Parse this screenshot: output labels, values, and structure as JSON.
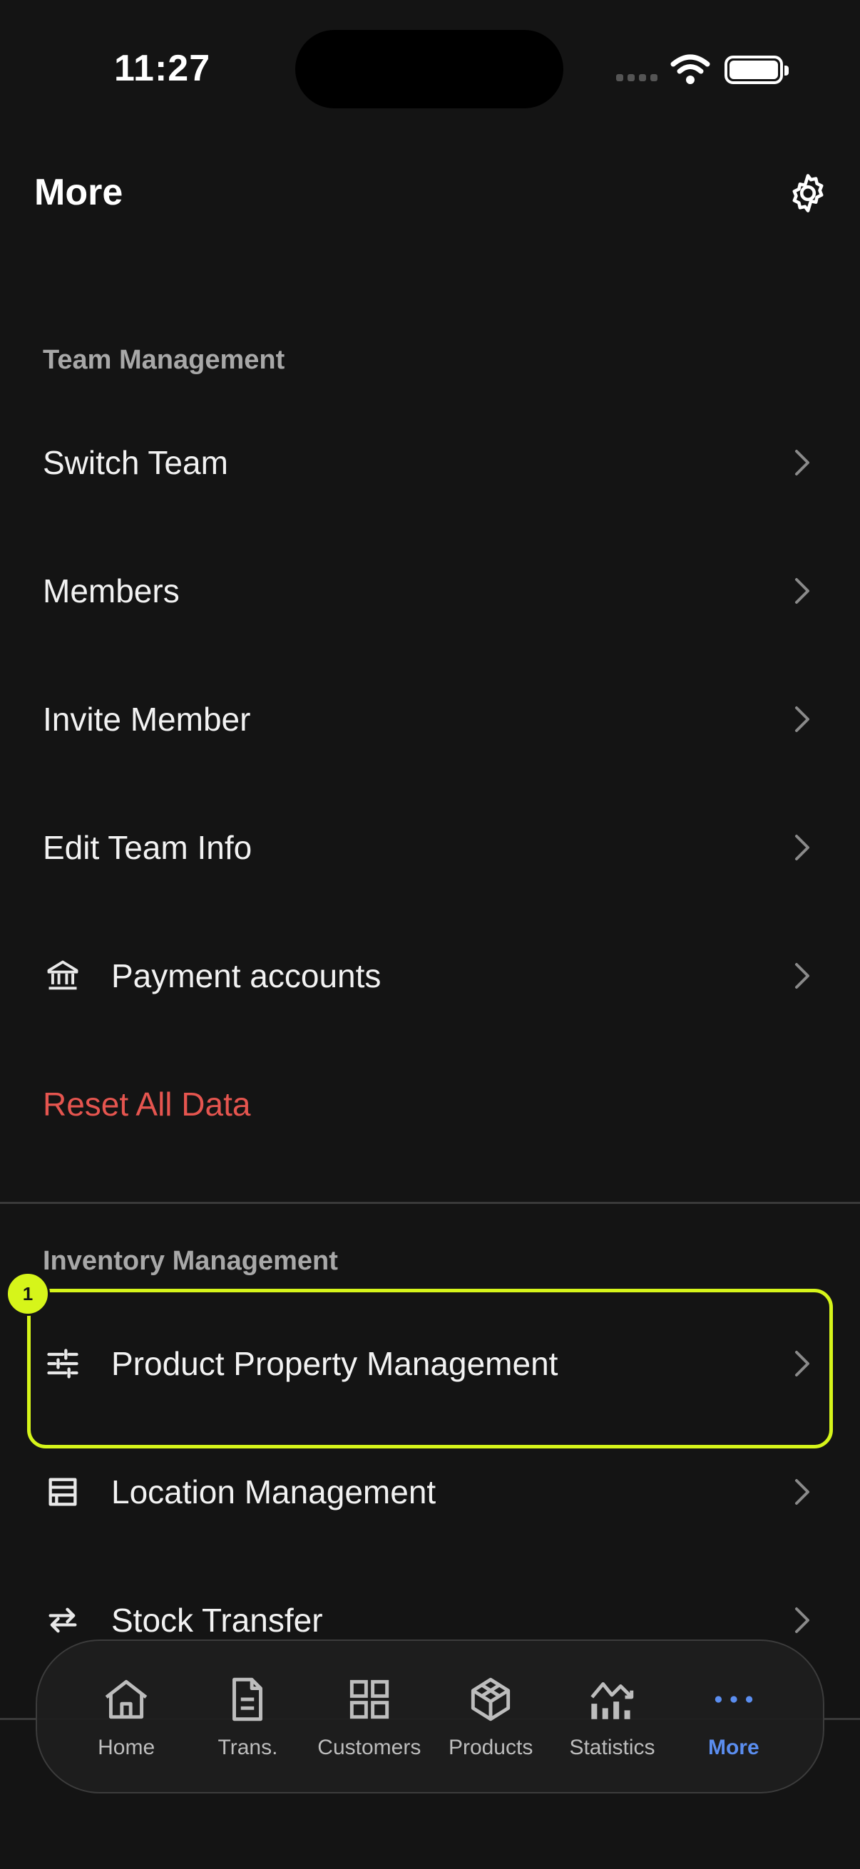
{
  "status": {
    "time": "11:27"
  },
  "header": {
    "title": "More"
  },
  "sections": {
    "team": {
      "title": "Team Management",
      "items": [
        {
          "label": "Switch Team"
        },
        {
          "label": "Members"
        },
        {
          "label": "Invite Member"
        },
        {
          "label": "Edit Team Info"
        },
        {
          "label": "Payment accounts",
          "icon": "bank-icon"
        },
        {
          "label": "Reset All Data"
        }
      ]
    },
    "inventory": {
      "title": "Inventory Management",
      "items": [
        {
          "label": "Product Property Management",
          "icon": "sliders-icon"
        },
        {
          "label": "Location Management",
          "icon": "store-icon"
        },
        {
          "label": "Stock Transfer",
          "icon": "transfer-arrows-icon"
        }
      ]
    }
  },
  "annotation": {
    "marker": "1",
    "color": "#d6f51a"
  },
  "tabbar": {
    "active_color": "#5b8ef0",
    "tabs": [
      {
        "label": "Home",
        "icon": "home-icon"
      },
      {
        "label": "Trans.",
        "icon": "document-icon"
      },
      {
        "label": "Customers",
        "icon": "grid-icon"
      },
      {
        "label": "Products",
        "icon": "cube-icon"
      },
      {
        "label": "Statistics",
        "icon": "bar-chart-icon"
      },
      {
        "label": "More",
        "icon": "more-dots-icon",
        "active": true
      }
    ]
  }
}
